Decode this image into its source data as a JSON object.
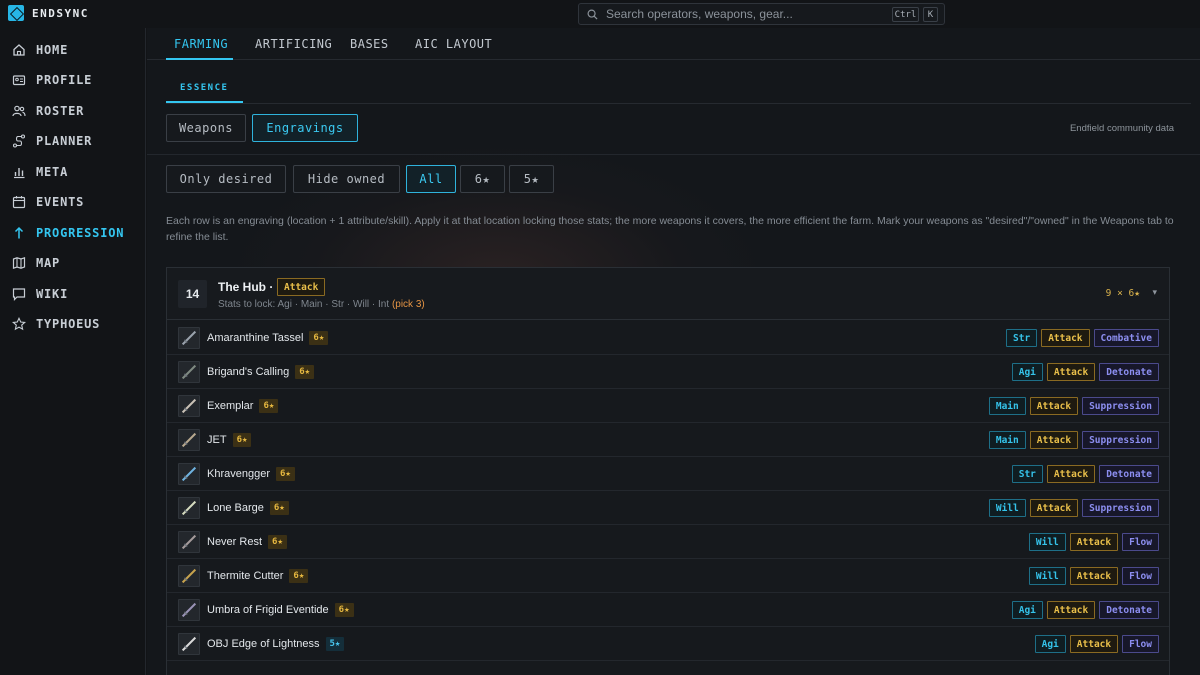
{
  "app": {
    "brand": "ENDSYNC",
    "search_placeholder": "Search operators, weapons, gear...",
    "kbd_ctrl": "Ctrl",
    "kbd_k": "K"
  },
  "sidebar": {
    "items": [
      {
        "label": "HOME",
        "icon": "home-icon"
      },
      {
        "label": "PROFILE",
        "icon": "id-card-icon"
      },
      {
        "label": "ROSTER",
        "icon": "users-icon"
      },
      {
        "label": "PLANNER",
        "icon": "route-icon"
      },
      {
        "label": "META",
        "icon": "bar-chart-icon"
      },
      {
        "label": "EVENTS",
        "icon": "calendar-icon"
      },
      {
        "label": "PROGRESSION",
        "icon": "arrow-up-icon",
        "active": true
      },
      {
        "label": "MAP",
        "icon": "map-icon"
      },
      {
        "label": "WIKI",
        "icon": "chat-icon"
      },
      {
        "label": "TYPHOEUS",
        "icon": "star-icon"
      }
    ]
  },
  "tabs": [
    "FARMING",
    "ARTIFICING",
    "BASES",
    "AIC LAYOUT"
  ],
  "subtab": "ESSENCE",
  "view_toggle": {
    "weapons": "Weapons",
    "engravings": "Engravings"
  },
  "community_note": "Endfield community data",
  "filters": {
    "only_desired": "Only desired",
    "hide_owned": "Hide owned",
    "all": "All",
    "six_star": "6★",
    "five_star": "5★"
  },
  "description": "Each row is an engraving (location + 1 attribute/skill). Apply it at that location locking those stats; the more weapons it covers, the more efficient the farm. Mark your weapons as \"desired\"/\"owned\" in the Weapons tab to refine the list.",
  "card": {
    "count": "14",
    "location": "The Hub ·",
    "tag": "Attack",
    "stats_lock": "Stats to lock: Agi · Main · Str · Will · Int",
    "pick": "(pick 3)",
    "summary": "9 × 6★",
    "chevron": "▾"
  },
  "weapons": [
    {
      "name": "Amaranthine Tassel",
      "rarity": "6★",
      "stat": "Str",
      "attack": "Attack",
      "skill": "Combative"
    },
    {
      "name": "Brigand's Calling",
      "rarity": "6★",
      "stat": "Agi",
      "attack": "Attack",
      "skill": "Detonate"
    },
    {
      "name": "Exemplar",
      "rarity": "6★",
      "stat": "Main",
      "attack": "Attack",
      "skill": "Suppression"
    },
    {
      "name": "JET",
      "rarity": "6★",
      "stat": "Main",
      "attack": "Attack",
      "skill": "Suppression"
    },
    {
      "name": "Khravengger",
      "rarity": "6★",
      "stat": "Str",
      "attack": "Attack",
      "skill": "Detonate"
    },
    {
      "name": "Lone Barge",
      "rarity": "6★",
      "stat": "Will",
      "attack": "Attack",
      "skill": "Suppression"
    },
    {
      "name": "Never Rest",
      "rarity": "6★",
      "stat": "Will",
      "attack": "Attack",
      "skill": "Flow"
    },
    {
      "name": "Thermite Cutter",
      "rarity": "6★",
      "stat": "Will",
      "attack": "Attack",
      "skill": "Flow"
    },
    {
      "name": "Umbra of Frigid Eventide",
      "rarity": "6★",
      "stat": "Agi",
      "attack": "Attack",
      "skill": "Detonate"
    },
    {
      "name": "OBJ Edge of Lightness",
      "rarity": "5★",
      "stat": "Agi",
      "attack": "Attack",
      "skill": "Flow"
    }
  ]
}
